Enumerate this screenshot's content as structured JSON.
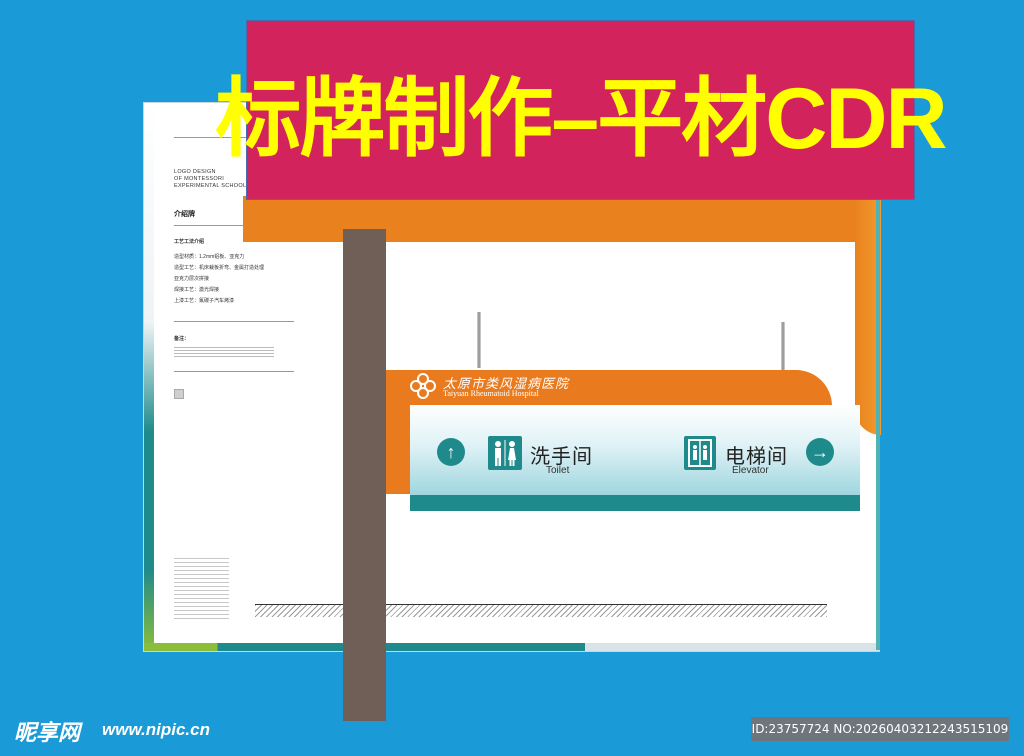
{
  "banner": {
    "title": "标牌制作–平材CDR"
  },
  "document": {
    "logo_lines": [
      "LOGO DESIGN",
      "OF MONTESSORI",
      "EXPERIMENTAL SCHOOL"
    ],
    "title": "介绍牌",
    "spec_heading": "工艺工法介绍",
    "specs": [
      "造型材质：1.2mm铝板、亚克力",
      "造型工艺：机床裁板折弯、金属打造处理",
      "亚克力层次拼接",
      "焊接工艺：激光焊接",
      "上漆工艺：氟碳子汽车烤漆"
    ],
    "note_heading": "备注："
  },
  "sign": {
    "hospital_cn": "太原市类风湿病医院",
    "hospital_en": "Taiyuan Rheumatoid Hospital",
    "left_arrow": "↑",
    "left_label_cn": "洗手间",
    "left_label_en": "Toilet",
    "right_arrow": "→",
    "right_label_cn": "电梯间",
    "right_label_en": "Elevator"
  },
  "watermark": {
    "site_cn": "昵享网",
    "site_url": "www.nipic.cn",
    "image_id": "ID:23757724 NO:20260403212243515109"
  },
  "colors": {
    "background": "#1b9ad8",
    "banner": "#d3235c",
    "banner_text": "#ffff00",
    "orange": "#e9821e",
    "teal": "#1f8a8c",
    "post": "#6f5f57"
  },
  "icons": [
    "up-arrow-icon",
    "restroom-icon",
    "elevator-icon",
    "right-arrow-icon",
    "hospital-logo-icon"
  ]
}
